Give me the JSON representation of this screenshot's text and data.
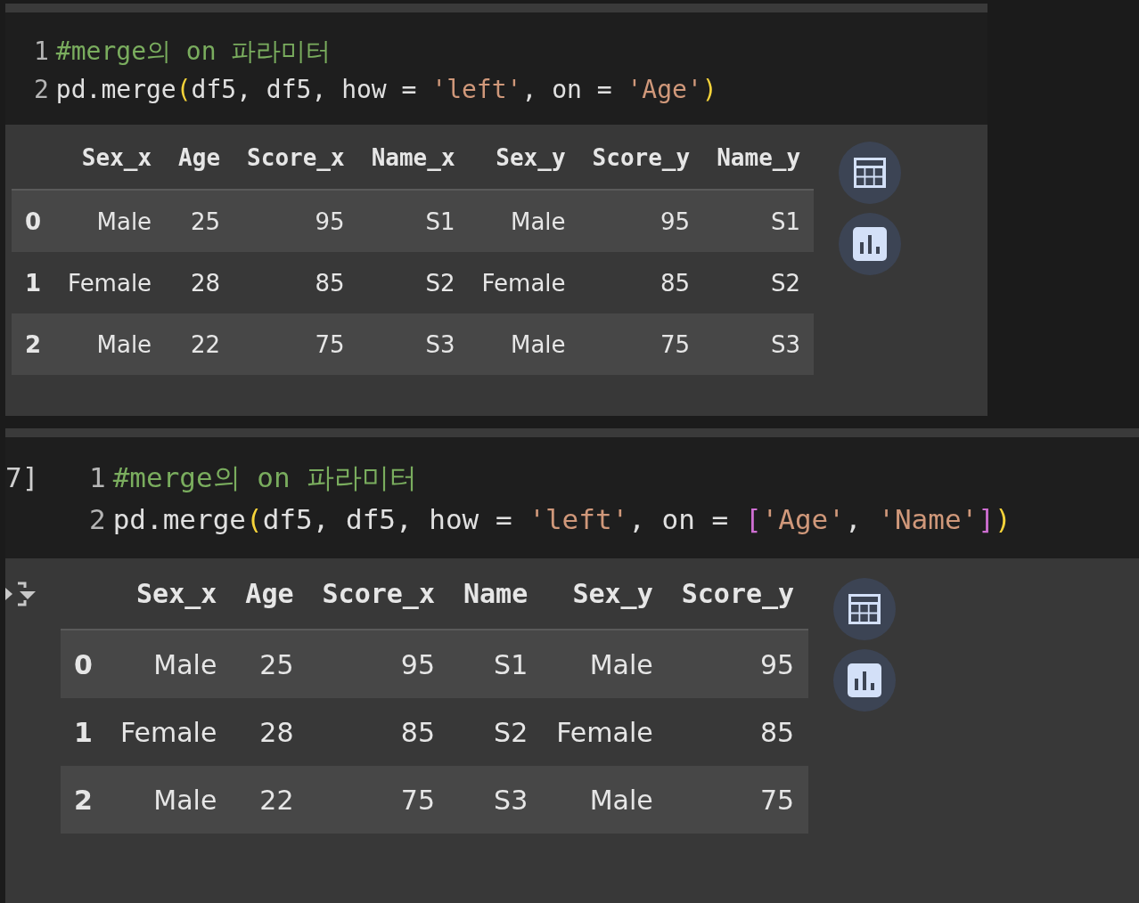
{
  "cells": [
    {
      "code_lines": [
        {
          "number": "1",
          "tokens": [
            {
              "kind": "comment",
              "text": "#merge의 on 파라미터"
            }
          ]
        },
        {
          "number": "2",
          "tokens": [
            {
              "kind": "plain",
              "text": "pd.merge"
            },
            {
              "kind": "paren",
              "text": "("
            },
            {
              "kind": "plain",
              "text": "df5, df5, how = "
            },
            {
              "kind": "string",
              "text": "'left'"
            },
            {
              "kind": "plain",
              "text": ", on = "
            },
            {
              "kind": "string",
              "text": "'Age'"
            },
            {
              "kind": "paren",
              "text": ")"
            }
          ]
        }
      ],
      "output": {
        "columns": [
          "Sex_x",
          "Age",
          "Score_x",
          "Name_x",
          "Sex_y",
          "Score_y",
          "Name_y"
        ],
        "rows": [
          {
            "index": "0",
            "cells": [
              "Male",
              "25",
              "95",
              "S1",
              "Male",
              "95",
              "S1"
            ]
          },
          {
            "index": "1",
            "cells": [
              "Female",
              "28",
              "85",
              "S2",
              "Female",
              "85",
              "S2"
            ]
          },
          {
            "index": "2",
            "cells": [
              "Male",
              "22",
              "75",
              "S3",
              "Male",
              "75",
              "S3"
            ]
          }
        ]
      }
    },
    {
      "execution_count": "7]",
      "code_lines": [
        {
          "number": "1",
          "tokens": [
            {
              "kind": "comment",
              "text": "#merge의 on 파라미터"
            }
          ]
        },
        {
          "number": "2",
          "tokens": [
            {
              "kind": "plain",
              "text": "pd.merge"
            },
            {
              "kind": "paren",
              "text": "("
            },
            {
              "kind": "plain",
              "text": "df5, df5, how = "
            },
            {
              "kind": "string",
              "text": "'left'"
            },
            {
              "kind": "plain",
              "text": ", on = "
            },
            {
              "kind": "bracket",
              "text": "["
            },
            {
              "kind": "string",
              "text": "'Age'"
            },
            {
              "kind": "plain",
              "text": ", "
            },
            {
              "kind": "string",
              "text": "'Name'"
            },
            {
              "kind": "bracket",
              "text": "]"
            },
            {
              "kind": "paren",
              "text": ")"
            }
          ]
        }
      ],
      "output": {
        "columns": [
          "Sex_x",
          "Age",
          "Score_x",
          "Name",
          "Sex_y",
          "Score_y"
        ],
        "rows": [
          {
            "index": "0",
            "cells": [
              "Male",
              "25",
              "95",
              "S1",
              "Male",
              "95"
            ]
          },
          {
            "index": "1",
            "cells": [
              "Female",
              "28",
              "85",
              "S2",
              "Female",
              "85"
            ]
          },
          {
            "index": "2",
            "cells": [
              "Male",
              "22",
              "75",
              "S3",
              "Male",
              "75"
            ]
          }
        ]
      }
    }
  ]
}
